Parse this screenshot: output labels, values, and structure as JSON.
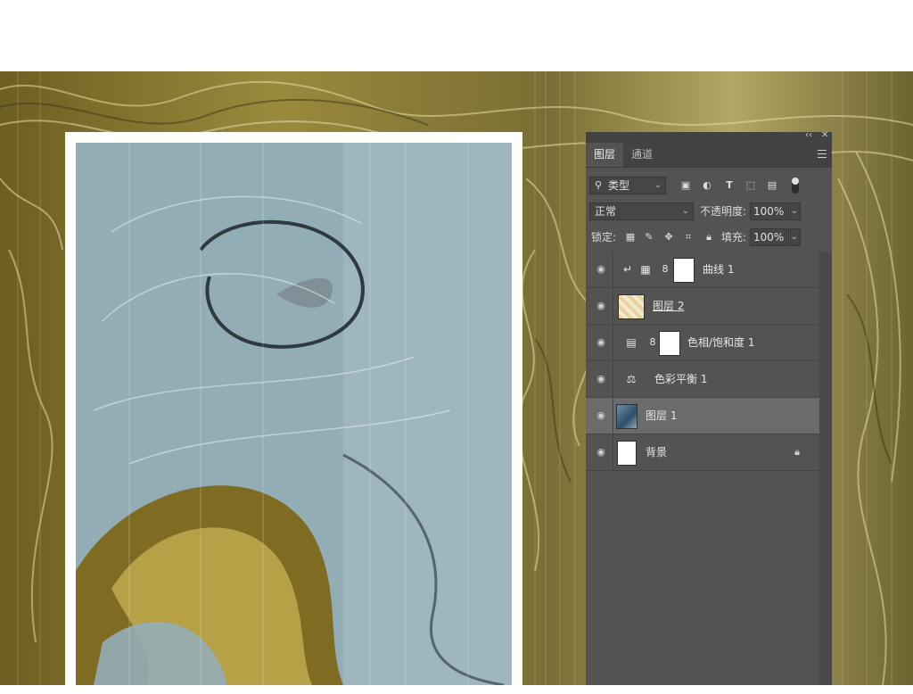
{
  "panel": {
    "collapse_icon": "collapse-icon",
    "close_icon": "close-icon",
    "collapse_glyph": "‹‹",
    "close_glyph": "✕",
    "tabs": [
      {
        "label": "图层",
        "active": true
      },
      {
        "label": "通道",
        "active": false
      }
    ],
    "filter": {
      "value": "类型"
    },
    "blend_mode": {
      "value": "正常"
    },
    "opacity": {
      "label": "不透明度:",
      "value": "100%"
    },
    "lock": {
      "label": "锁定:"
    },
    "fill": {
      "label": "填充:",
      "value": "100%"
    },
    "layers": [
      {
        "name": "曲线 1",
        "kind": "adjustment-curves",
        "selected": false
      },
      {
        "name": "图层 2",
        "kind": "pixel",
        "selected": false
      },
      {
        "name": "色相/饱和度 1",
        "kind": "adjustment-hue",
        "selected": false
      },
      {
        "name": "色彩平衡 1",
        "kind": "adjustment-balance",
        "selected": false
      },
      {
        "name": "图层 1",
        "kind": "pixel",
        "selected": true
      },
      {
        "name": "背景",
        "kind": "background",
        "selected": false,
        "locked": true
      }
    ]
  },
  "colors": {
    "panel_bg": "#535353",
    "selected_layer": "#6b6b6b",
    "gold": "#b8a046",
    "teal": "#8fa9b3"
  }
}
